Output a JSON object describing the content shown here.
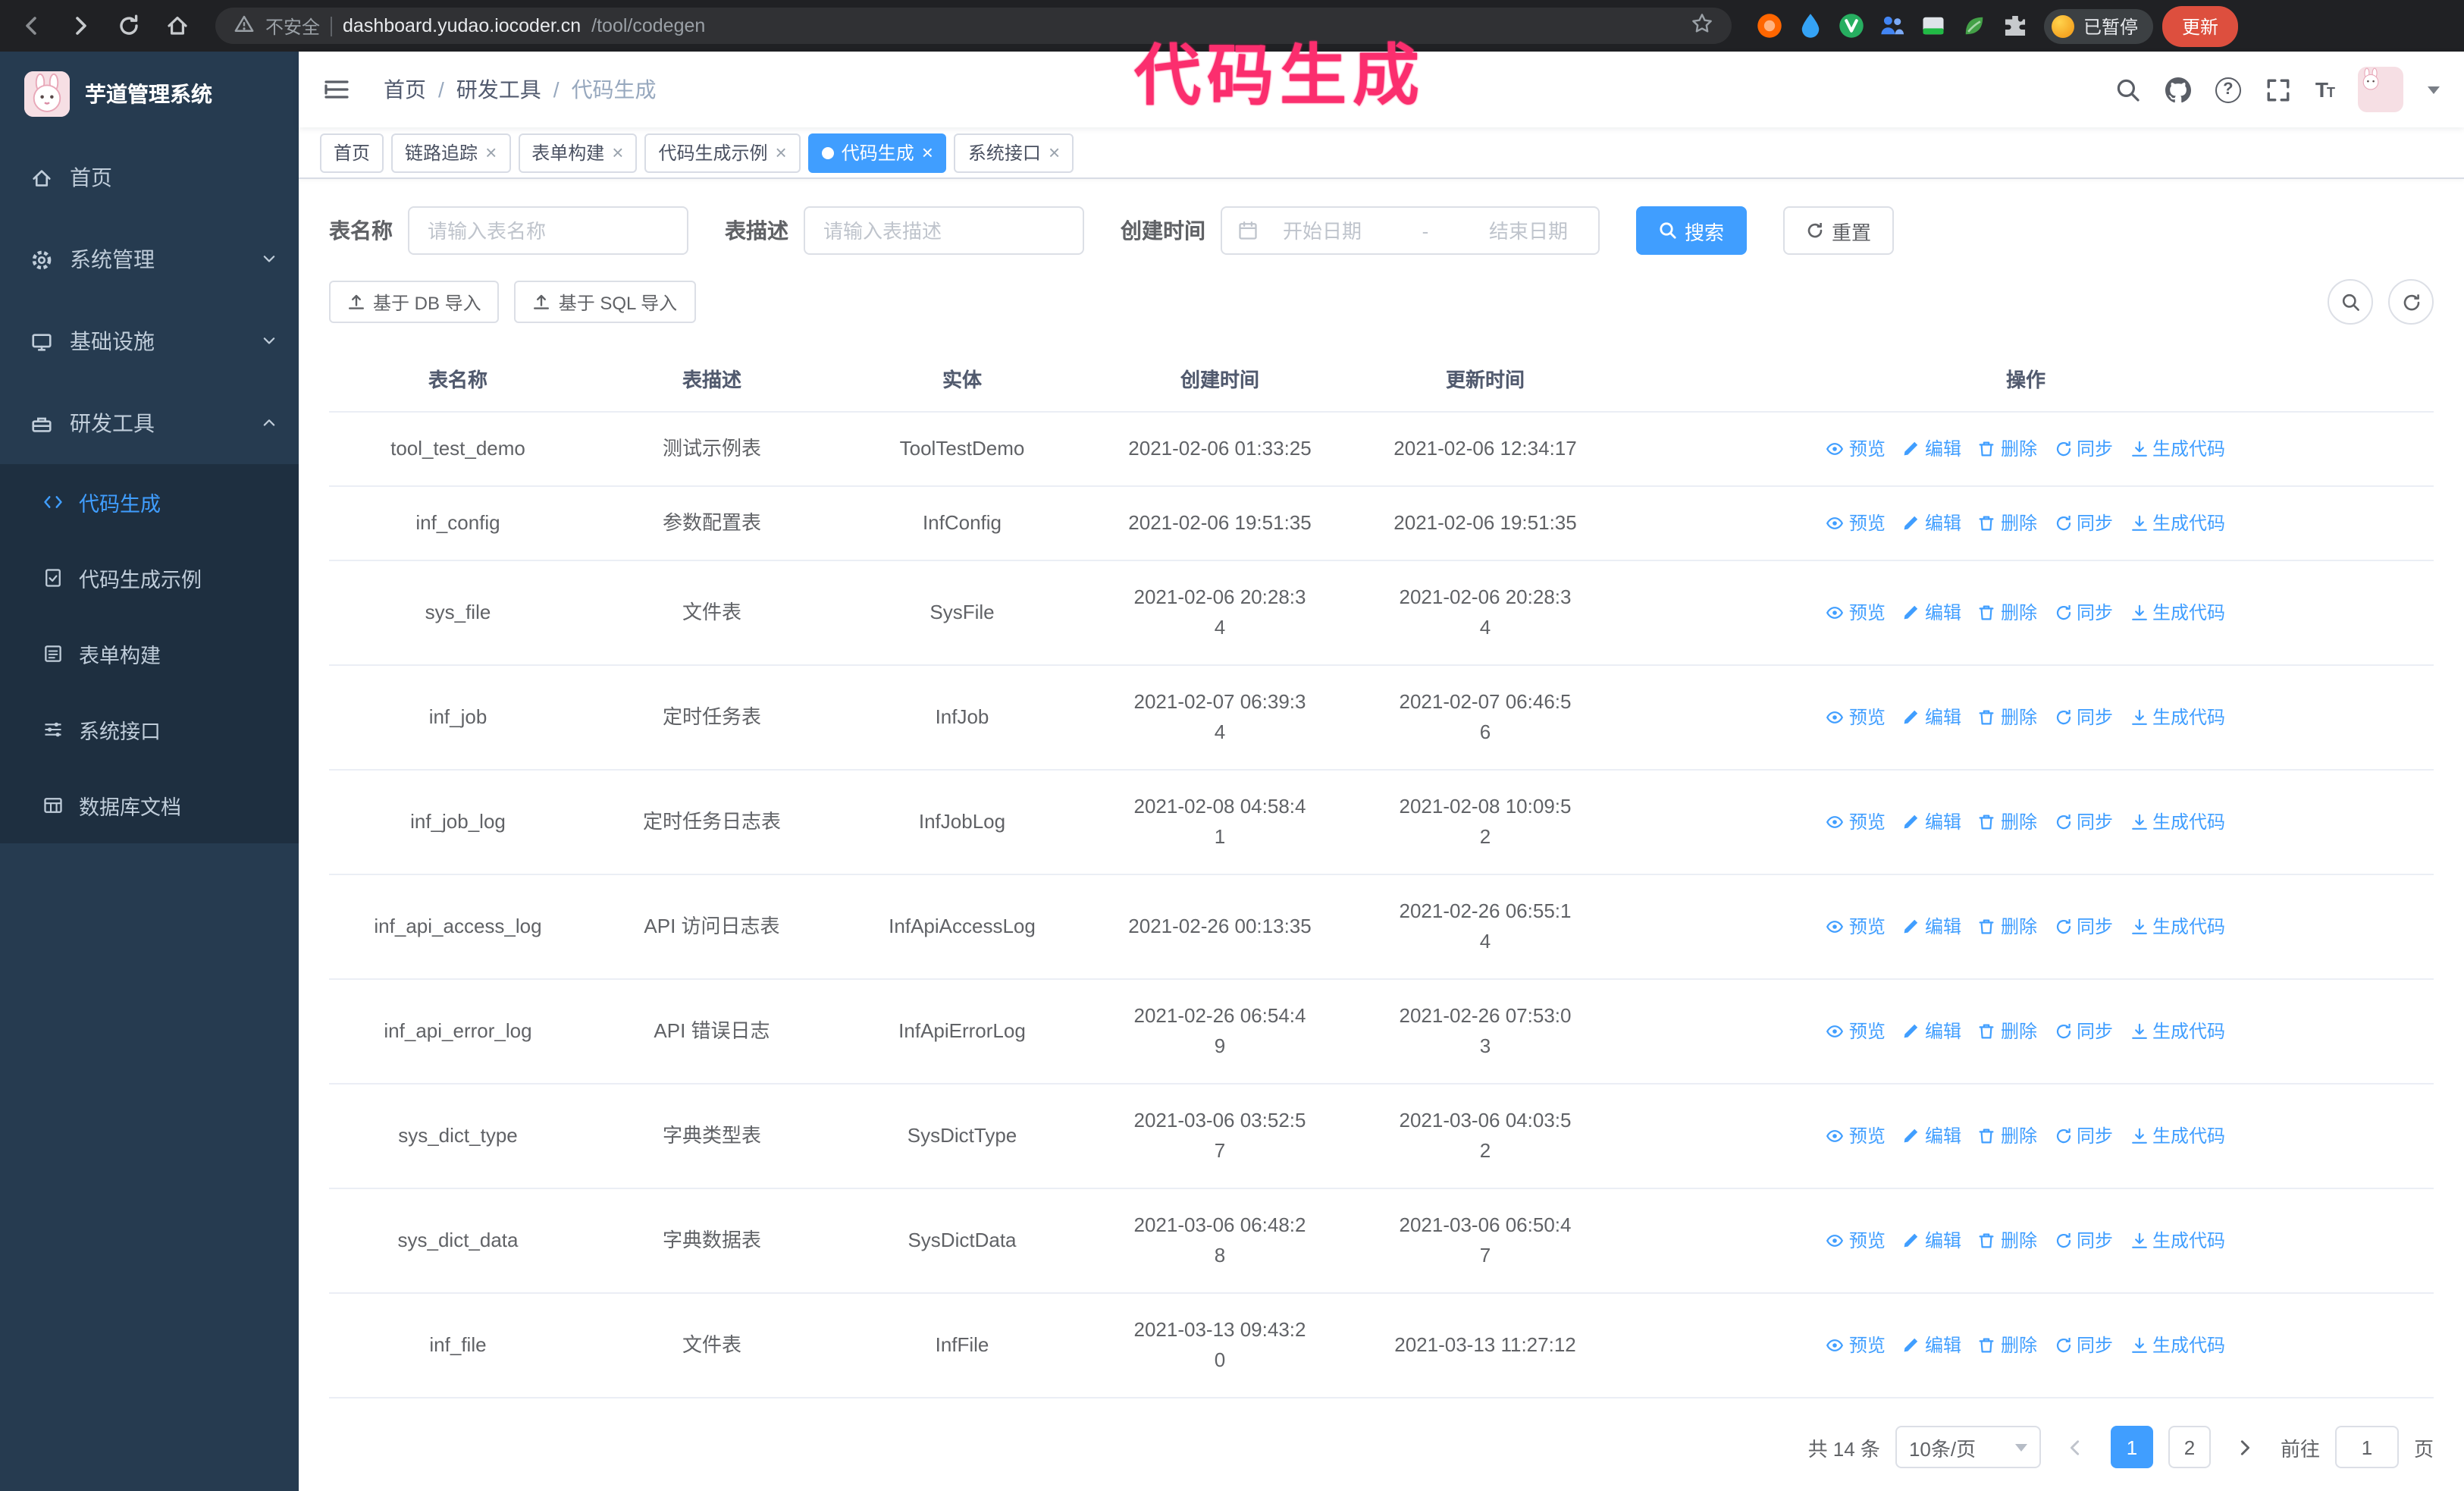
{
  "annotation": {
    "text": "代码生成"
  },
  "browser": {
    "security": "不安全",
    "url_host": "dashboard.yudao.iocoder.cn",
    "url_path": "/tool/codegen",
    "paused": "已暂停",
    "update": "更新"
  },
  "sidebar": {
    "title": "芋道管理系统",
    "items": [
      {
        "label": "首页"
      },
      {
        "label": "系统管理"
      },
      {
        "label": "基础设施"
      },
      {
        "label": "研发工具"
      }
    ],
    "submenu": [
      {
        "label": "代码生成"
      },
      {
        "label": "代码生成示例"
      },
      {
        "label": "表单构建"
      },
      {
        "label": "系统接口"
      },
      {
        "label": "数据库文档"
      }
    ]
  },
  "navbar": {
    "breadcrumb": {
      "home": "首页",
      "group": "研发工具",
      "current": "代码生成"
    },
    "separator": "/"
  },
  "tabs": [
    {
      "label": "首页"
    },
    {
      "label": "链路追踪"
    },
    {
      "label": "表单构建"
    },
    {
      "label": "代码生成示例"
    },
    {
      "label": "代码生成"
    },
    {
      "label": "系统接口"
    }
  ],
  "filters": {
    "name_label": "表名称",
    "name_placeholder": "请输入表名称",
    "desc_label": "表描述",
    "desc_placeholder": "请输入表描述",
    "time_label": "创建时间",
    "start_placeholder": "开始日期",
    "separator": "-",
    "end_placeholder": "结束日期",
    "search": "搜索",
    "reset": "重置"
  },
  "toolbar": {
    "import_db": "基于 DB 导入",
    "import_sql": "基于 SQL 导入"
  },
  "table": {
    "columns": [
      "表名称",
      "表描述",
      "实体",
      "创建时间",
      "更新时间",
      "操作"
    ],
    "actions": {
      "preview": "预览",
      "edit": "编辑",
      "delete": "删除",
      "sync": "同步",
      "generate": "生成代码"
    },
    "rows": [
      {
        "name": "tool_test_demo",
        "desc": "测试示例表",
        "entity": "ToolTestDemo",
        "created": "2021-02-06 01:33:25",
        "updated": "2021-02-06 12:34:17"
      },
      {
        "name": "inf_config",
        "desc": "参数配置表",
        "entity": "InfConfig",
        "created": "2021-02-06 19:51:35",
        "updated": "2021-02-06 19:51:35"
      },
      {
        "name": "sys_file",
        "desc": "文件表",
        "entity": "SysFile",
        "created": "2021-02-06 20:28:3\n4",
        "updated": "2021-02-06 20:28:3\n4"
      },
      {
        "name": "inf_job",
        "desc": "定时任务表",
        "entity": "InfJob",
        "created": "2021-02-07 06:39:3\n4",
        "updated": "2021-02-07 06:46:5\n6"
      },
      {
        "name": "inf_job_log",
        "desc": "定时任务日志表",
        "entity": "InfJobLog",
        "created": "2021-02-08 04:58:4\n1",
        "updated": "2021-02-08 10:09:5\n2"
      },
      {
        "name": "inf_api_access_log",
        "desc": "API 访问日志表",
        "entity": "InfApiAccessLog",
        "created": "2021-02-26 00:13:35",
        "updated": "2021-02-26 06:55:1\n4"
      },
      {
        "name": "inf_api_error_log",
        "desc": "API 错误日志",
        "entity": "InfApiErrorLog",
        "created": "2021-02-26 06:54:4\n9",
        "updated": "2021-02-26 07:53:0\n3"
      },
      {
        "name": "sys_dict_type",
        "desc": "字典类型表",
        "entity": "SysDictType",
        "created": "2021-03-06 03:52:5\n7",
        "updated": "2021-03-06 04:03:5\n2"
      },
      {
        "name": "sys_dict_data",
        "desc": "字典数据表",
        "entity": "SysDictData",
        "created": "2021-03-06 06:48:2\n8",
        "updated": "2021-03-06 06:50:4\n7"
      },
      {
        "name": "inf_file",
        "desc": "文件表",
        "entity": "InfFile",
        "created": "2021-03-13 09:43:2\n0",
        "updated": "2021-03-13 11:27:12"
      }
    ]
  },
  "pagination": {
    "total": "共 14 条",
    "page_size": "10条/页",
    "page1": "1",
    "page2": "2",
    "goto_label": "前往",
    "goto_value": "1",
    "page_unit": "页"
  }
}
